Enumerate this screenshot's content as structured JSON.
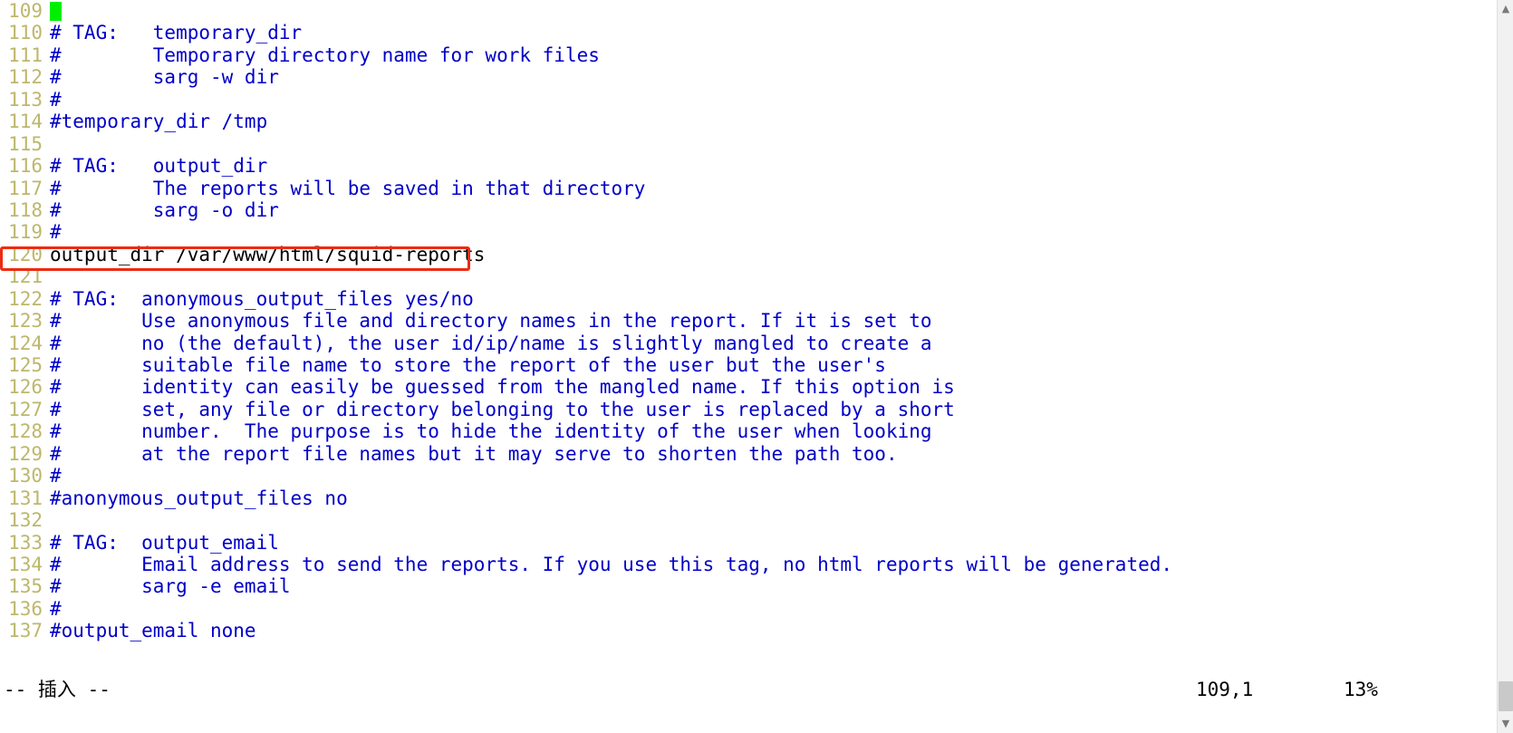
{
  "editor": {
    "app": "vim",
    "colors": {
      "background": "#ffffff",
      "line_number": "#bdb76b",
      "comment": "#0000c8",
      "normal_text": "#000000",
      "cursor": "#00ef00",
      "annotation": "#ef2a10"
    },
    "cursor_line_number": "109",
    "lines": [
      {
        "num": "109",
        "text": "",
        "kind": "cursor"
      },
      {
        "num": "110",
        "text": "# TAG:   temporary_dir",
        "kind": "comment"
      },
      {
        "num": "111",
        "text": "#        Temporary directory name for work files",
        "kind": "comment"
      },
      {
        "num": "112",
        "text": "#        sarg -w dir",
        "kind": "comment"
      },
      {
        "num": "113",
        "text": "#",
        "kind": "comment"
      },
      {
        "num": "114",
        "text": "#temporary_dir /tmp",
        "kind": "comment"
      },
      {
        "num": "115",
        "text": "",
        "kind": "comment"
      },
      {
        "num": "116",
        "text": "# TAG:   output_dir",
        "kind": "comment"
      },
      {
        "num": "117",
        "text": "#        The reports will be saved in that directory",
        "kind": "comment"
      },
      {
        "num": "118",
        "text": "#        sarg -o dir",
        "kind": "comment"
      },
      {
        "num": "119",
        "text": "#",
        "kind": "comment"
      },
      {
        "num": "120",
        "text": "output_dir /var/www/html/squid-reports",
        "kind": "plain"
      },
      {
        "num": "121",
        "text": "",
        "kind": "comment"
      },
      {
        "num": "122",
        "text": "# TAG:  anonymous_output_files yes/no",
        "kind": "comment"
      },
      {
        "num": "123",
        "text": "#       Use anonymous file and directory names in the report. If it is set to",
        "kind": "comment"
      },
      {
        "num": "124",
        "text": "#       no (the default), the user id/ip/name is slightly mangled to create a",
        "kind": "comment"
      },
      {
        "num": "125",
        "text": "#       suitable file name to store the report of the user but the user's",
        "kind": "comment"
      },
      {
        "num": "126",
        "text": "#       identity can easily be guessed from the mangled name. If this option is",
        "kind": "comment"
      },
      {
        "num": "127",
        "text": "#       set, any file or directory belonging to the user is replaced by a short",
        "kind": "comment"
      },
      {
        "num": "128",
        "text": "#       number.  The purpose is to hide the identity of the user when looking",
        "kind": "comment"
      },
      {
        "num": "129",
        "text": "#       at the report file names but it may serve to shorten the path too.",
        "kind": "comment"
      },
      {
        "num": "130",
        "text": "#",
        "kind": "comment"
      },
      {
        "num": "131",
        "text": "#anonymous_output_files no",
        "kind": "comment"
      },
      {
        "num": "132",
        "text": "",
        "kind": "comment"
      },
      {
        "num": "133",
        "text": "# TAG:  output_email",
        "kind": "comment"
      },
      {
        "num": "134",
        "text": "#       Email address to send the reports. If you use this tag, no html reports will be generated.",
        "kind": "comment"
      },
      {
        "num": "135",
        "text": "#       sarg -e email",
        "kind": "comment"
      },
      {
        "num": "136",
        "text": "#",
        "kind": "comment"
      },
      {
        "num": "137",
        "text": "#output_email none",
        "kind": "comment"
      }
    ]
  },
  "annotation": {
    "target_line": "120",
    "target_text": "output_dir /var/www/html/squid-reports"
  },
  "statusline": {
    "mode": "-- 插入 --",
    "ruler": "109,1",
    "percent": "13%"
  },
  "scrollbar": {
    "up_arrow": "scroll-up",
    "down_arrow": "scroll-down"
  }
}
